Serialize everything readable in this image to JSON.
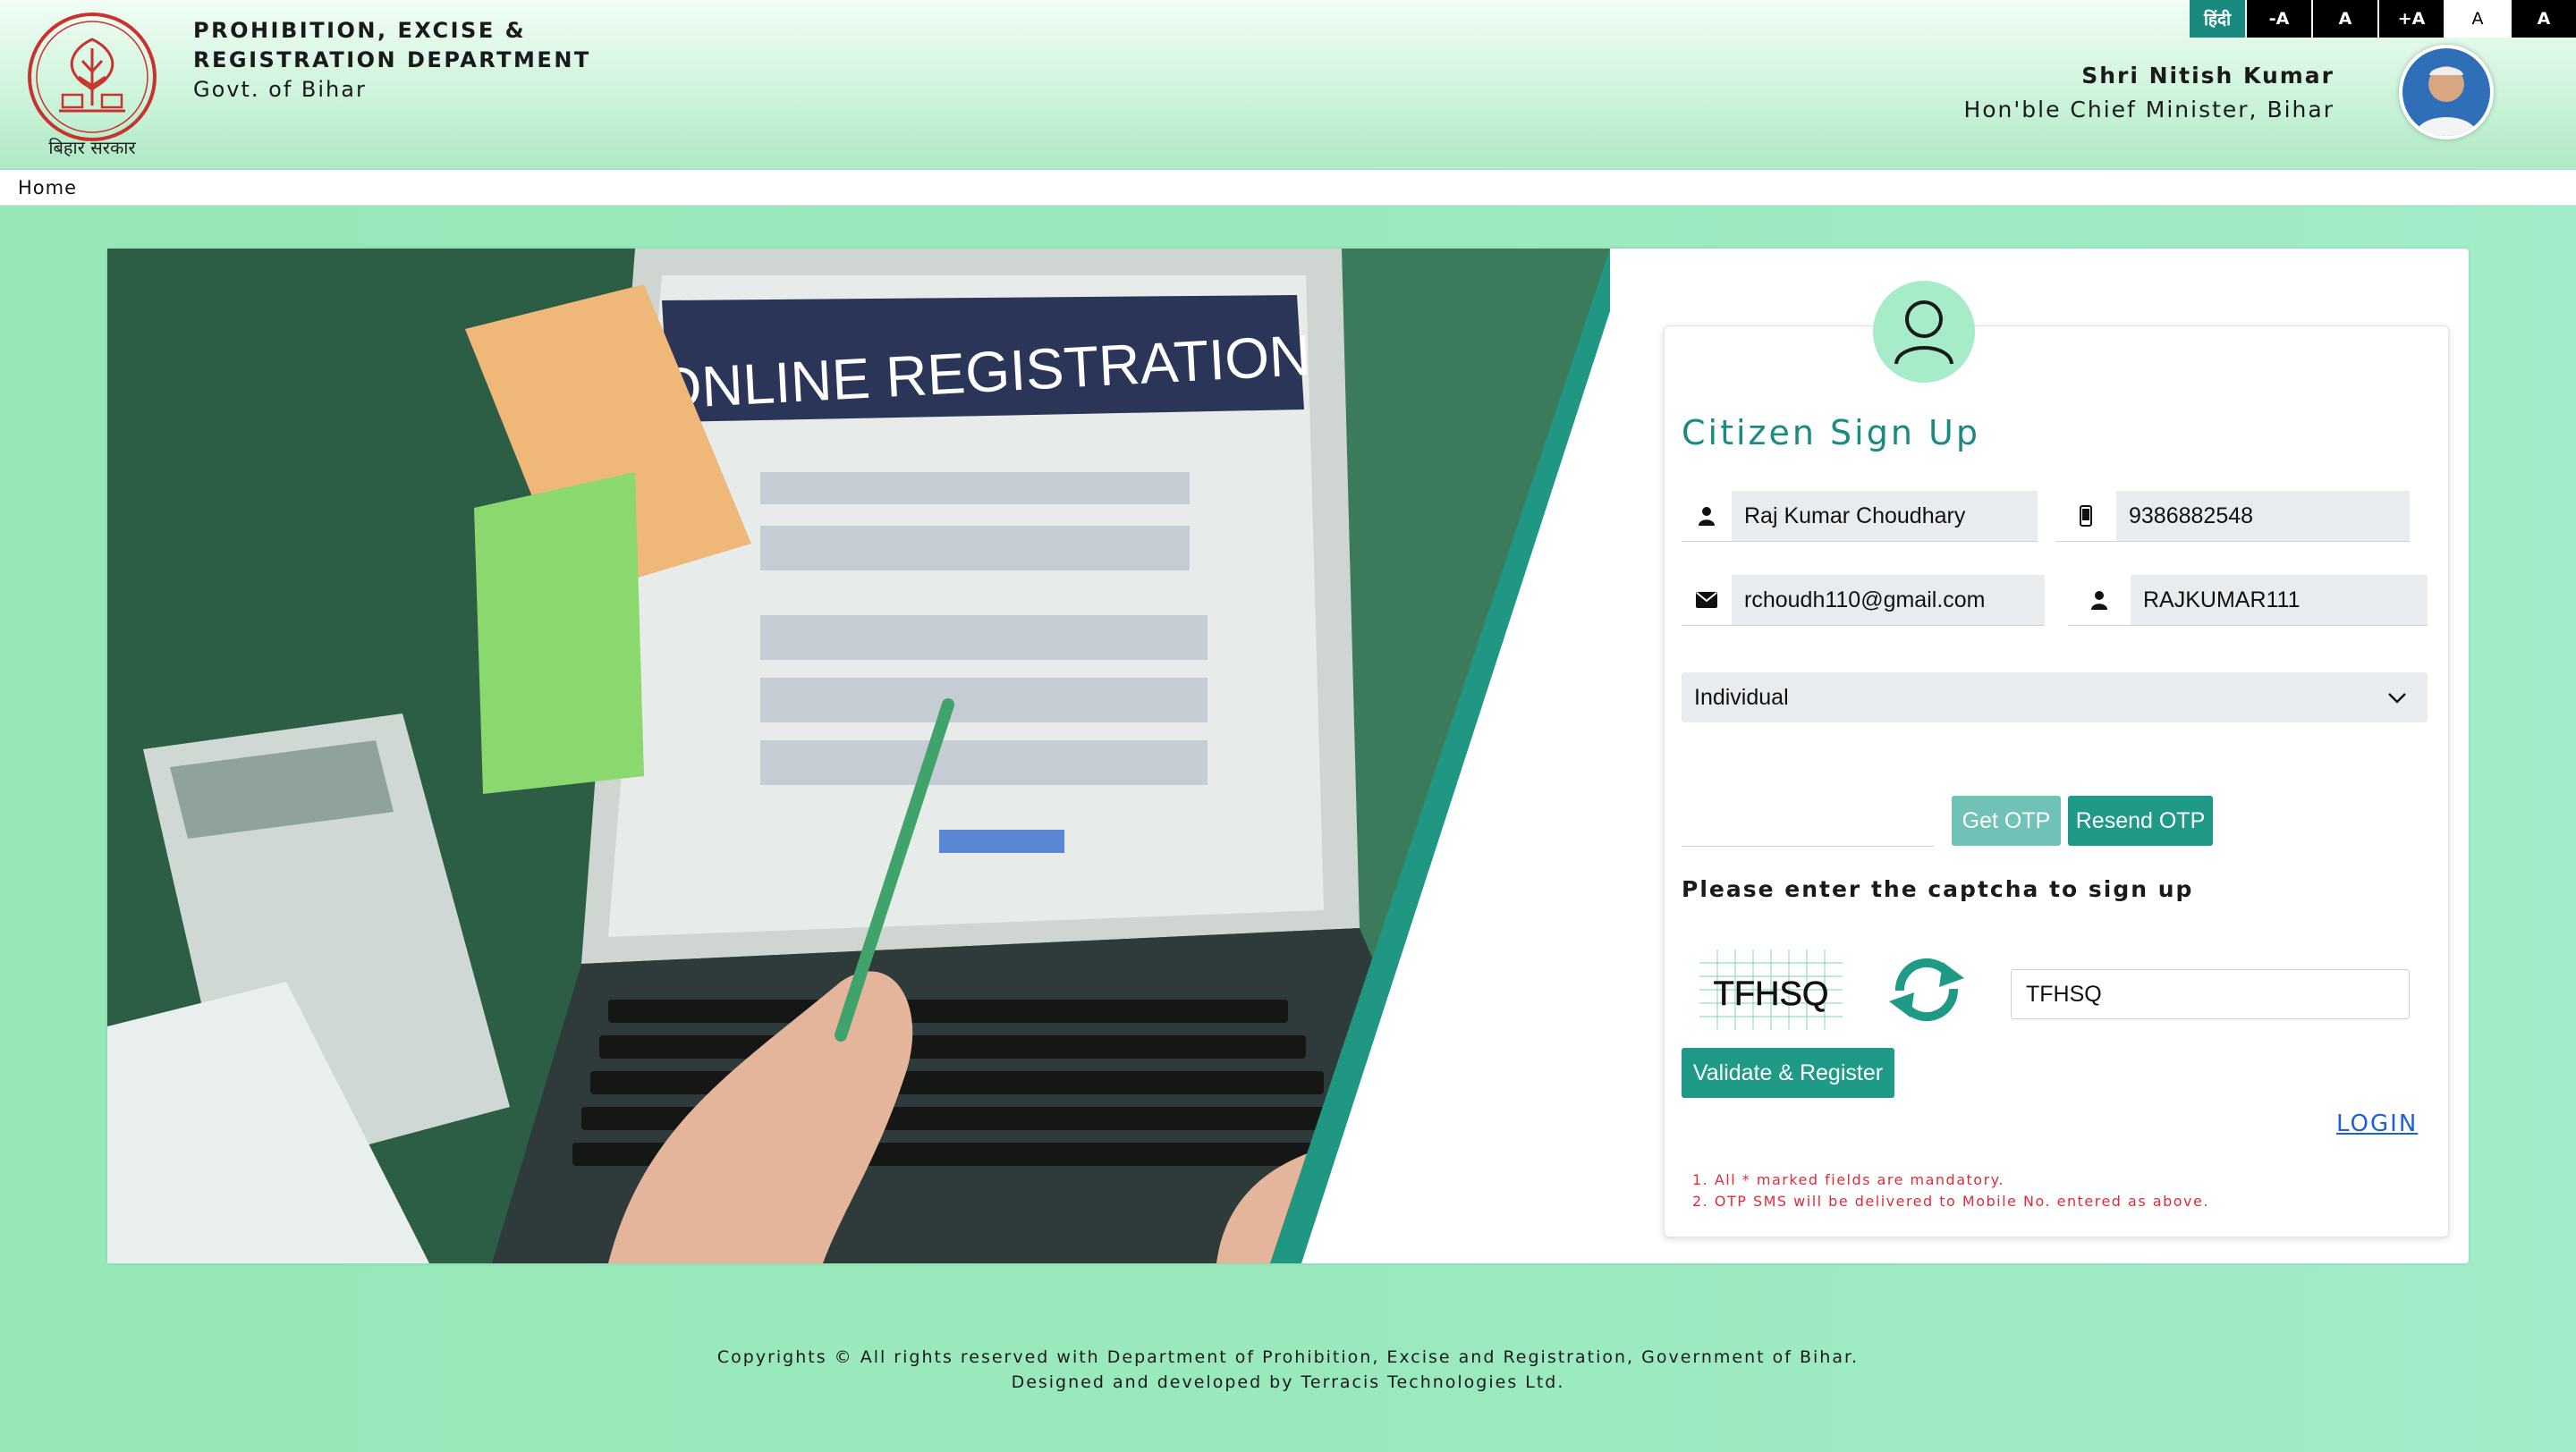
{
  "header": {
    "dept_line1": "PROHIBITION, EXCISE &",
    "dept_line2": "REGISTRATION DEPARTMENT",
    "dept_line3": "Govt. of Bihar",
    "emblem_caption": "बिहार सरकार",
    "cm_name": "Shri Nitish Kumar",
    "cm_title": "Hon'ble Chief Minister, Bihar"
  },
  "accessibility": {
    "hindi": "हिंदी",
    "font_decrease": "-A",
    "font_normal": "A",
    "font_increase": "+A",
    "theme_light": "A",
    "theme_dark": "A"
  },
  "nav": {
    "home": "Home"
  },
  "hero": {
    "heading": "ONLINE REGISTRATION"
  },
  "form": {
    "title": "Citizen Sign Up",
    "full_name": "Raj Kumar Choudhary",
    "mobile": "9386882548",
    "email": "rchoudh110@gmail.com",
    "username": "RAJKUMAR111",
    "user_type": "Individual",
    "get_otp": "Get OTP",
    "resend_otp": "Resend OTP",
    "captcha_label": "Please enter the captcha to sign up",
    "captcha_text": "TFHSQ",
    "captcha_value": "TFHSQ",
    "validate_button": "Validate & Register",
    "login_link": "LOGIN",
    "note1": "1. All * marked fields are mandatory.",
    "note2": "2. OTP SMS will be delivered to Mobile No. entered as above."
  },
  "footer": {
    "line1": "Copyrights © All rights reserved with Department of Prohibition, Excise and Registration, Government of Bihar.",
    "line2": "Designed and developed by Terracis Technologies Ltd."
  },
  "colors": {
    "accent": "#1f9a87",
    "title": "#1c8a80",
    "link": "#1f5fd8",
    "note": "#e02c3a"
  }
}
